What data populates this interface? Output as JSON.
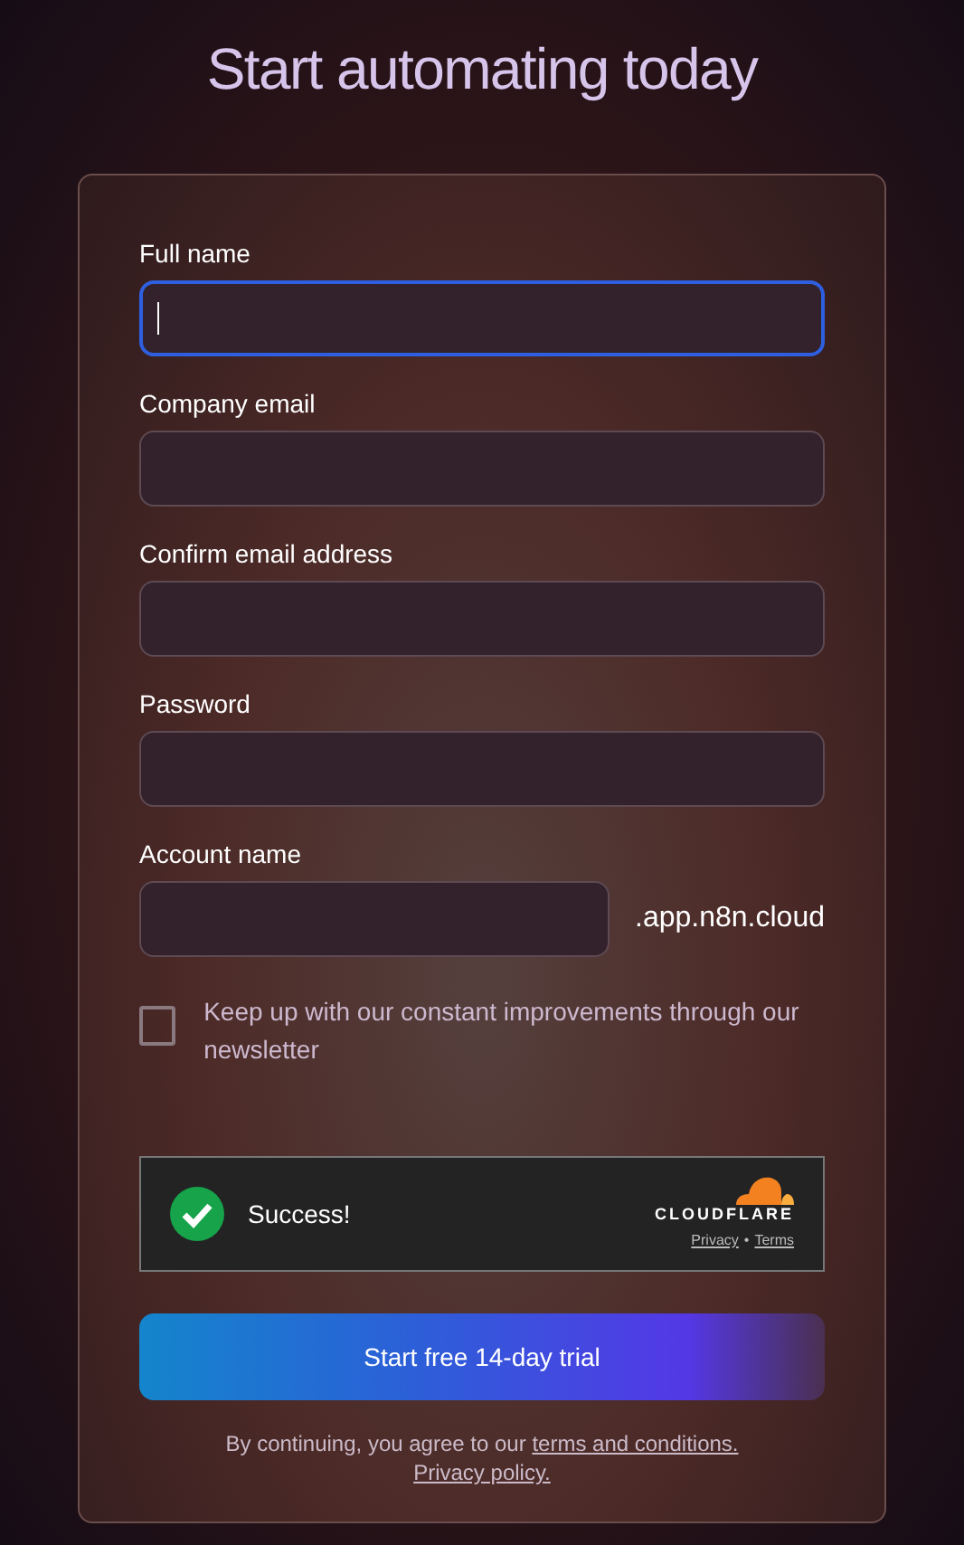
{
  "title": "Start automating today",
  "fields": [
    {
      "label": "Full name",
      "focused": true
    },
    {
      "label": "Company email",
      "focused": false
    },
    {
      "label": "Confirm email address",
      "focused": false
    },
    {
      "label": "Password",
      "focused": false
    },
    {
      "label": "Account name",
      "focused": false,
      "suffix": ".app.n8n.cloud"
    }
  ],
  "newsletter": {
    "label": "Keep up with our constant improvements through our newsletter",
    "checked": false
  },
  "captcha": {
    "status": "Success!",
    "brand": "CLOUDFLARE",
    "links": [
      "Privacy",
      "Terms"
    ],
    "separator": "•"
  },
  "submit": "Start free 14-day trial",
  "footer": {
    "text": "By continuing, you agree to our",
    "links": [
      "terms and conditions.",
      "Privacy policy."
    ]
  }
}
